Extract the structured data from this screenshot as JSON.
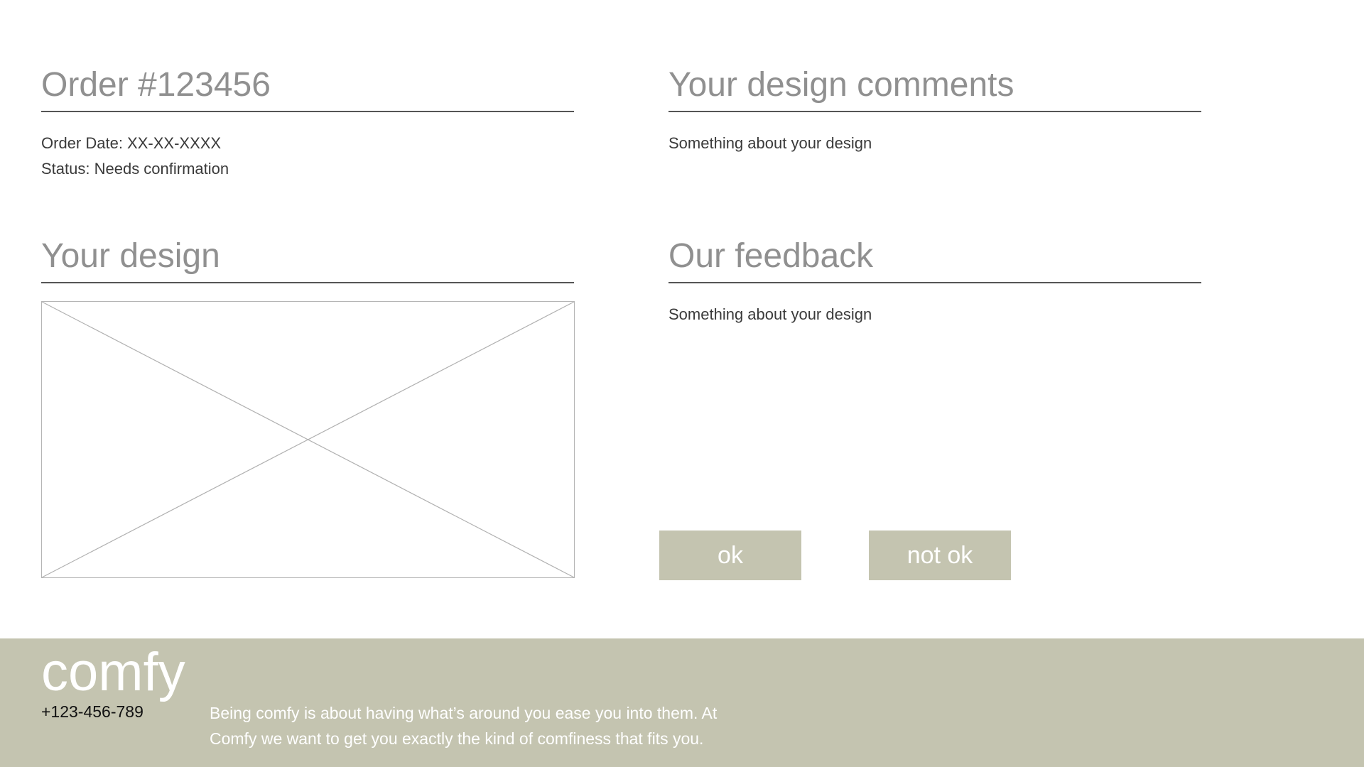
{
  "order": {
    "title": "Order #123456",
    "date_line": "Order Date: XX-XX-XXXX",
    "status_line": "Status: Needs confirmation"
  },
  "comments": {
    "title": "Your design comments",
    "text": "Something about your design"
  },
  "design": {
    "title": "Your design",
    "image_icon": "image-placeholder-icon"
  },
  "feedback": {
    "title": "Our feedback",
    "text": "Something about your design"
  },
  "actions": {
    "ok_label": "ok",
    "not_ok_label": "not ok"
  },
  "footer": {
    "brand": "comfy",
    "phone": "+123-456-789",
    "tagline_line1": "Being comfy is about having what’s around you ease you into them. At",
    "tagline_line2": "Comfy we want to get you exactly the kind of comfiness that fits you."
  },
  "colors": {
    "accent": "#c4c4b0",
    "heading": "#909090",
    "body_text": "#3a3a3a"
  }
}
